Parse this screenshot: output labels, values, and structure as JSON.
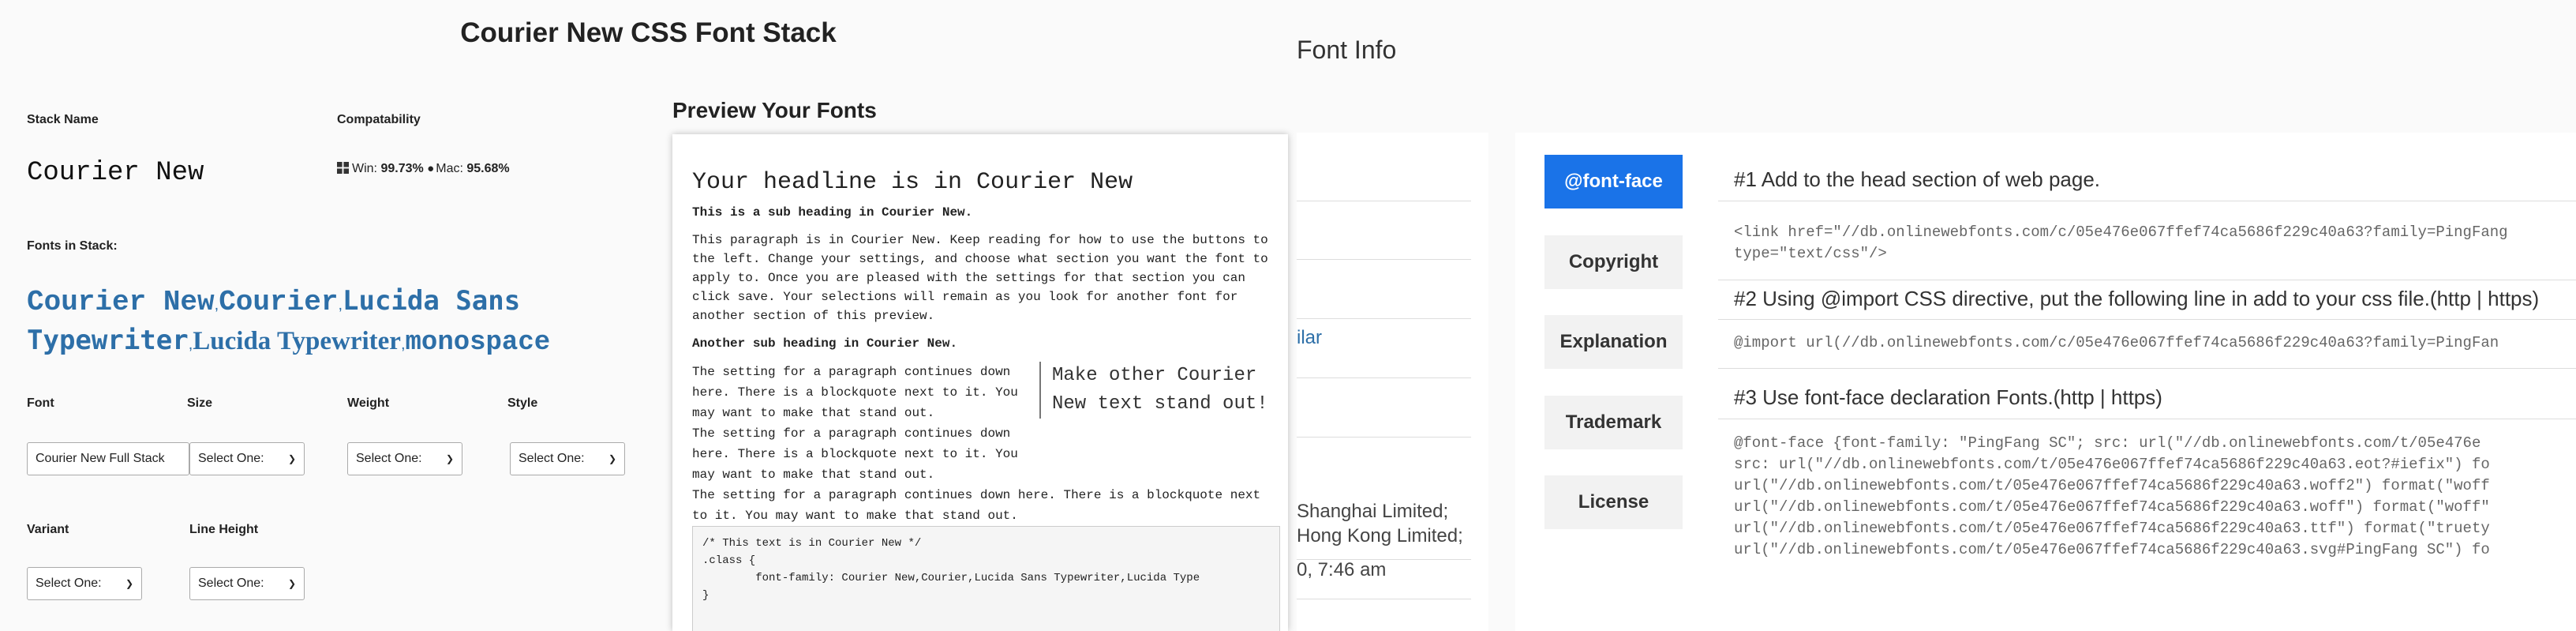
{
  "left": {
    "title": "Courier New CSS Font Stack",
    "stack_name_label": "Stack Name",
    "stack_name_value": "Courier New",
    "compat_label": "Compatability",
    "compat_win_label": "Win:",
    "compat_win_value": "99.73%",
    "compat_mac_label": "Mac:",
    "compat_mac_value": "95.68%",
    "fonts_in_stack_label": "Fonts in Stack:",
    "fonts_in_stack": [
      "Courier New",
      "Courier",
      "Lucida Sans Typewriter",
      "Lucida Typewriter",
      "monospace"
    ],
    "font_label": "Font",
    "font_value": "Courier New Full Stack",
    "size_label": "Size",
    "size_value": "Select One:",
    "weight_label": "Weight",
    "weight_value": "Select One:",
    "style_label": "Style",
    "style_value": "Select One:",
    "variant_label": "Variant",
    "variant_value": "Select One:",
    "line_height_label": "Line Height",
    "line_height_value": "Select One:"
  },
  "preview": {
    "title": "Preview Your Fonts",
    "headline": "Your headline is in Courier New",
    "sub1": "This is a sub heading in Courier New.",
    "para1": "This paragraph is in Courier New. Keep reading for how to use the buttons to the left. Change your settings, and choose what section you want the font to apply to. Once you are pleased with the settings for that section you can click save. Your selections will remain as you look for another font for another section of this preview.",
    "sub2": "Another sub heading in Courier New.",
    "para2_line": "The setting for a paragraph continues down here. There is a blockquote next to it. You may want to make that stand out.",
    "para2_last": "The setting for a paragraph continues down here. There is a blockquote next to it. You may want to make that stand out.",
    "quote": "Make other Courier New text stand out!",
    "code": "/* This text is in Courier New */\n.class {\n        font-family: Courier New,Courier,Lucida Sans Typewriter,Lucida Type\n}"
  },
  "right": {
    "title": "Font Info",
    "info_text_1": "ilar",
    "info_text_2": "Shanghai Limited;",
    "info_text_3": "Hong Kong Limited;",
    "info_text_4": "0, 7:46 am",
    "tabs": [
      "@font-face",
      "Copyright",
      "Explanation",
      "Trademark",
      "License"
    ],
    "section1_head": "#1 Add to the head section of web page.",
    "section1_code": "<link href=\"//db.onlinewebfonts.com/c/05e476e067ffef74ca5686f229c40a63?family=PingFang\ntype=\"text/css\"/>",
    "section2_head": "#2 Using @import CSS directive, put the following line in add to your css file.(http | https)",
    "section2_code": "@import url(//db.onlinewebfonts.com/c/05e476e067ffef74ca5686f229c40a63?family=PingFan",
    "section3_head": "#3 Use font-face declaration Fonts.(http | https)",
    "section3_code": "@font-face {font-family: \"PingFang SC\"; src: url(\"//db.onlinewebfonts.com/t/05e476e\nsrc: url(\"//db.onlinewebfonts.com/t/05e476e067ffef74ca5686f229c40a63.eot?#iefix\") fo\nurl(\"//db.onlinewebfonts.com/t/05e476e067ffef74ca5686f229c40a63.woff2\") format(\"woff\nurl(\"//db.onlinewebfonts.com/t/05e476e067ffef74ca5686f229c40a63.woff\") format(\"woff\"\nurl(\"//db.onlinewebfonts.com/t/05e476e067ffef74ca5686f229c40a63.ttf\") format(\"truety\nurl(\"//db.onlinewebfonts.com/t/05e476e067ffef74ca5686f229c40a63.svg#PingFang SC\") fo"
  },
  "colors": {
    "accent_blue": "#1a73e8",
    "stack_blue": "#2d6fa8",
    "panel_bg": "#fafafa"
  }
}
